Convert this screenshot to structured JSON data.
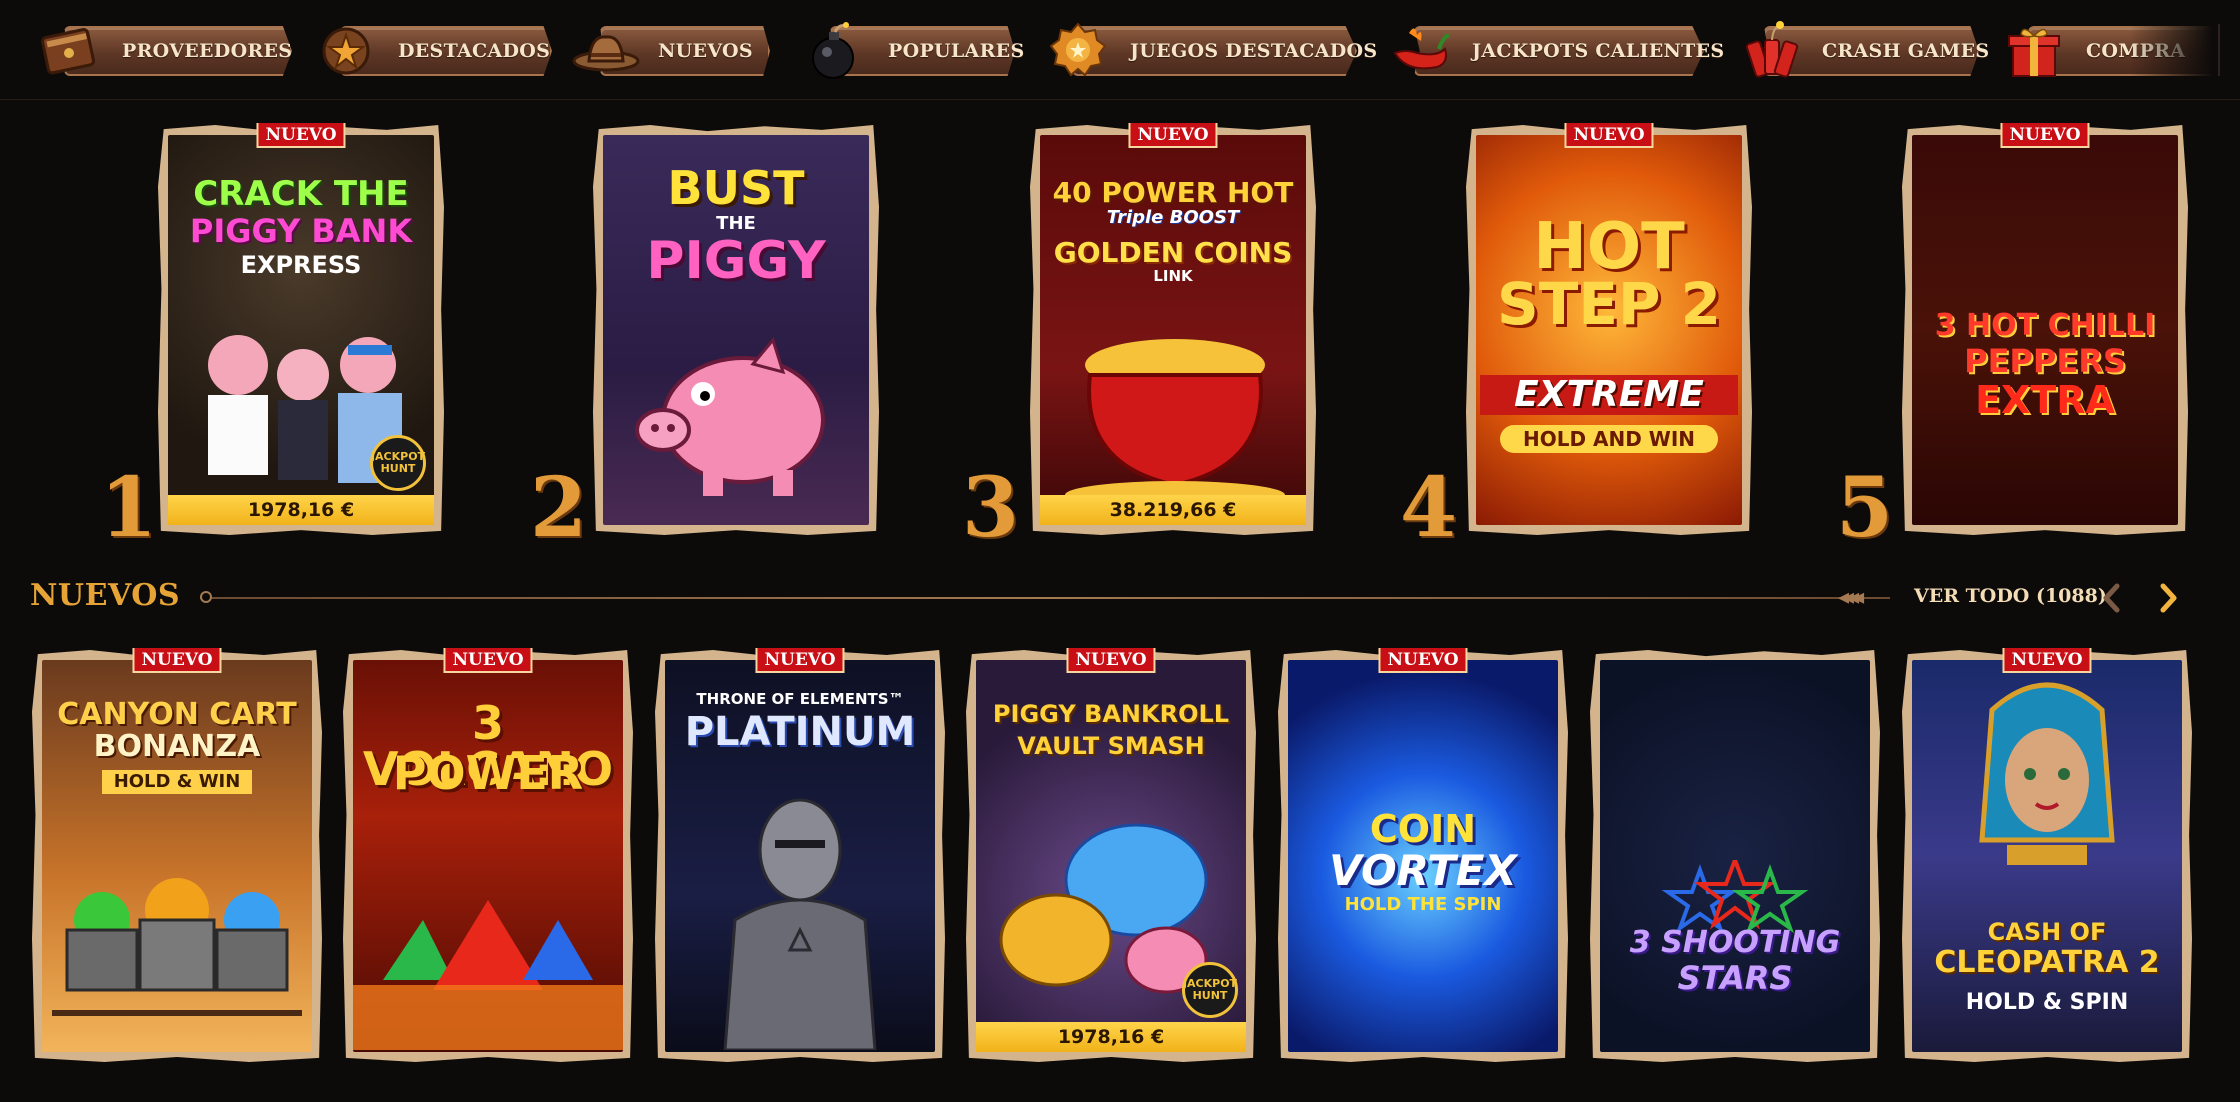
{
  "nav": {
    "items": [
      {
        "label": "PROVEEDORES",
        "icon": "book-icon"
      },
      {
        "label": "DESTACADOS",
        "icon": "star-badge-icon"
      },
      {
        "label": "NUEVOS",
        "icon": "cowboy-hat-icon"
      },
      {
        "label": "POPULARES",
        "icon": "bomb-icon"
      },
      {
        "label": "JUEGOS DESTACADOS",
        "icon": "medal-icon"
      },
      {
        "label": "JACKPOTS CALIENTES",
        "icon": "chili-pepper-icon"
      },
      {
        "label": "CRASH GAMES",
        "icon": "dynamite-icon"
      },
      {
        "label": "COMPRA",
        "icon": "gift-icon"
      }
    ]
  },
  "top": {
    "games": [
      {
        "rank": "1",
        "badge": "NUEVO",
        "title_lines": [
          "CRACK THE",
          "PIGGY BANK",
          "EXPRESS"
        ],
        "tag": "JACKPOT HUNT",
        "jackpot": "1978,16 €"
      },
      {
        "rank": "2",
        "badge": "",
        "title_lines": [
          "BUST",
          "THE",
          "PIGGY"
        ],
        "tag": "",
        "jackpot": ""
      },
      {
        "rank": "3",
        "badge": "NUEVO",
        "title_lines": [
          "40 POWER HOT",
          "Triple BOOST",
          "GOLDEN COINS",
          "LINK"
        ],
        "tag": "",
        "jackpot": "38.219,66 €"
      },
      {
        "rank": "4",
        "badge": "NUEVO",
        "title_lines": [
          "HOT",
          "STEP 2",
          "EXTREME",
          "HOLD AND WIN"
        ],
        "tag": "",
        "jackpot": ""
      },
      {
        "rank": "5",
        "badge": "NUEVO",
        "title_lines": [
          "3 HOT CHILLI",
          "PEPPERS",
          "EXTRA"
        ],
        "tag": "",
        "jackpot": ""
      }
    ]
  },
  "section": {
    "title": "NUEVOS",
    "view_all": "VER TODO (1088)",
    "prev_icon": "chevron-left-icon",
    "next_icon": "chevron-right-icon"
  },
  "new_games": [
    {
      "badge": "NUEVO",
      "title_lines": [
        "CANYON CART",
        "BONANZA",
        "HOLD & WIN"
      ],
      "tag": "",
      "jackpot": ""
    },
    {
      "badge": "NUEVO",
      "title_lines": [
        "3 VOLCANO",
        "POWER"
      ],
      "tag": "",
      "jackpot": ""
    },
    {
      "badge": "NUEVO",
      "title_lines": [
        "THRONE OF ELEMENTS™",
        "PLATINUM"
      ],
      "tag": "",
      "jackpot": ""
    },
    {
      "badge": "NUEVO",
      "title_lines": [
        "PIGGY BANKROLL",
        "VAULT SMASH"
      ],
      "tag": "JACKPOT HUNT",
      "jackpot": "1978,16 €"
    },
    {
      "badge": "NUEVO",
      "title_lines": [
        "COIN",
        "VORTEX",
        "HOLD THE SPIN"
      ],
      "tag": "",
      "jackpot": ""
    },
    {
      "badge": "",
      "title_lines": [
        "3 SHOOTING",
        "STARS"
      ],
      "tag": "",
      "jackpot": ""
    },
    {
      "badge": "NUEVO",
      "title_lines": [
        "CASH OF",
        "CLEOPATRA 2",
        "HOLD & SPIN"
      ],
      "tag": "",
      "jackpot": ""
    }
  ]
}
